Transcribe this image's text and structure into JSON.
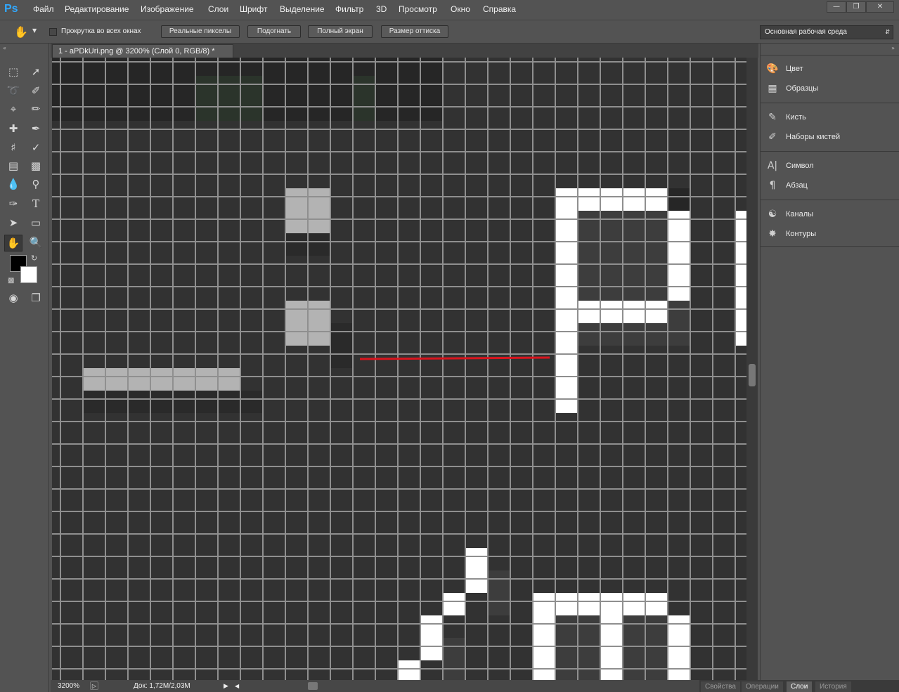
{
  "app": {
    "logo": "Ps"
  },
  "menu": [
    "Файл",
    "Редактирование",
    "Изображение",
    "Слои",
    "Шрифт",
    "Выделение",
    "Фильтр",
    "3D",
    "Просмотр",
    "Окно",
    "Справка"
  ],
  "options": {
    "scroll_all": "Прокрутка во всех окнах",
    "actual_pixels": "Реальные пикселы",
    "fit": "Подогнать",
    "fill_screen": "Полный экран",
    "print_size": "Размер оттиска",
    "workspace": "Основная рабочая среда"
  },
  "document": {
    "tab_title": "1 - aPDkUri.png @ 3200% (Слой 0, RGB/8) *"
  },
  "status": {
    "zoom": "3200%",
    "doc_size": "Док: 1,72M/2,03M"
  },
  "panels": [
    {
      "label": "Цвет",
      "icon": "palette-icon"
    },
    {
      "label": "Образцы",
      "icon": "swatches-icon"
    },
    {
      "label": "Кисть",
      "icon": "brush-icon"
    },
    {
      "label": "Наборы кистей",
      "icon": "brush-presets-icon"
    },
    {
      "label": "Символ",
      "icon": "character-icon"
    },
    {
      "label": "Абзац",
      "icon": "paragraph-icon"
    },
    {
      "label": "Каналы",
      "icon": "channels-icon"
    },
    {
      "label": "Контуры",
      "icon": "paths-icon"
    }
  ],
  "bottom_tabs": [
    "Свойства",
    "Операции",
    "Слои",
    "История"
  ],
  "active_bottom_tab": "Слои",
  "colors": {
    "foreground": "#000000",
    "background": "#ffffff",
    "accent": "#31a8ff",
    "annotation_line": "#d9151e"
  }
}
